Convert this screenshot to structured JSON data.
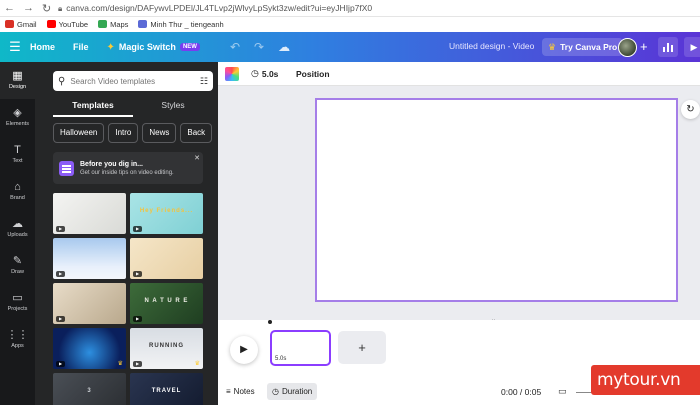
{
  "browser": {
    "url": "canva.com/design/DAFywvLPDEl/JL4TLvp2jWlvyLpSykt3zw/edit?ui=eyJHIjp7fX0",
    "bookmarks": [
      {
        "label": "Gmail",
        "icon": "gmail-icon",
        "color": "#d93025"
      },
      {
        "label": "YouTube",
        "icon": "youtube-icon",
        "color": "#ff0000"
      },
      {
        "label": "Maps",
        "icon": "maps-icon",
        "color": "#34a853"
      },
      {
        "label": "Minh Thư _ tiengeanh",
        "icon": "bookmark-icon",
        "color": "#5b6ad6"
      }
    ]
  },
  "topbar": {
    "home": "Home",
    "file": "File",
    "magic_switch": "Magic Switch",
    "new_badge": "NEW",
    "doc_title": "Untitled design - Video",
    "try_pro": "Try Canva Pro"
  },
  "rail": [
    {
      "label": "Design",
      "icon": "design-icon",
      "glyph": "▦",
      "active": true
    },
    {
      "label": "Elements",
      "icon": "elements-icon",
      "glyph": "◈",
      "active": false
    },
    {
      "label": "Text",
      "icon": "text-icon",
      "glyph": "T",
      "active": false
    },
    {
      "label": "Brand",
      "icon": "brand-icon",
      "glyph": "⌂",
      "active": false
    },
    {
      "label": "Uploads",
      "icon": "uploads-icon",
      "glyph": "☁",
      "active": false
    },
    {
      "label": "Draw",
      "icon": "draw-icon",
      "glyph": "✎",
      "active": false
    },
    {
      "label": "Projects",
      "icon": "projects-icon",
      "glyph": "▭",
      "active": false
    },
    {
      "label": "Apps",
      "icon": "apps-icon",
      "glyph": "⋮⋮",
      "active": false
    }
  ],
  "panel": {
    "search_placeholder": "Search Video templates",
    "tabs": [
      "Templates",
      "Styles"
    ],
    "chips": [
      "Halloween",
      "Intro",
      "News",
      "Back"
    ],
    "promo_title": "Before you dig in...",
    "promo_subtitle": "Get our inside tips on video editing."
  },
  "templates": [
    {
      "col": 0,
      "row": 0,
      "bg": "linear-gradient(135deg,#f4f4f2,#d9dad6)",
      "text": "",
      "text_color": "#555",
      "crown": false
    },
    {
      "col": 1,
      "row": 0,
      "bg": "linear-gradient(135deg,#a9e4e6,#7fd0d4)",
      "text": "Hey Friends...",
      "text_color": "#f6c23a",
      "crown": false
    },
    {
      "col": 0,
      "row": 1,
      "bg": "linear-gradient(180deg,#a8c9ee,#e8f0fb 70%,#f3f6fb)",
      "text": "",
      "text_color": "#fff",
      "crown": false
    },
    {
      "col": 1,
      "row": 1,
      "bg": "linear-gradient(135deg,#f5e6c8,#e7cfa3)",
      "text": "",
      "text_color": "#b07a3a",
      "crown": false
    },
    {
      "col": 0,
      "row": 2,
      "bg": "linear-gradient(135deg,#e8dcc8,#b9a88c)",
      "text": "",
      "text_color": "#333",
      "crown": false
    },
    {
      "col": 1,
      "row": 2,
      "bg": "linear-gradient(135deg,#3d6b3a,#1f3e21)",
      "text": "N A T U R E",
      "text_color": "#f0f0e8",
      "crown": false
    },
    {
      "col": 0,
      "row": 3,
      "bg": "radial-gradient(circle at 50% 60%,#2d8fe0,#0a1f5c 70%)",
      "text": "",
      "text_color": "#fff",
      "crown": true
    },
    {
      "col": 1,
      "row": 3,
      "bg": "linear-gradient(180deg,#d8dde3,#f2f3f5)",
      "text": "RUNNING",
      "text_color": "#333",
      "crown": true
    },
    {
      "col": 0,
      "row": 4,
      "bg": "linear-gradient(135deg,#4a4f56,#2a2d31)",
      "text": "3",
      "text_color": "#cfd3d8",
      "crown": false
    },
    {
      "col": 1,
      "row": 4,
      "bg": "linear-gradient(135deg,#2a3550,#121a2e)",
      "text": "TRAVEL",
      "text_color": "#fff",
      "crown": false
    }
  ],
  "editor": {
    "duration": "5.0s",
    "position": "Position"
  },
  "timeline": {
    "clip_duration": "5.0s",
    "notes": "Notes",
    "duration_btn": "Duration",
    "timecode": "0:00 / 0:05"
  },
  "watermark": "mytour.vn"
}
